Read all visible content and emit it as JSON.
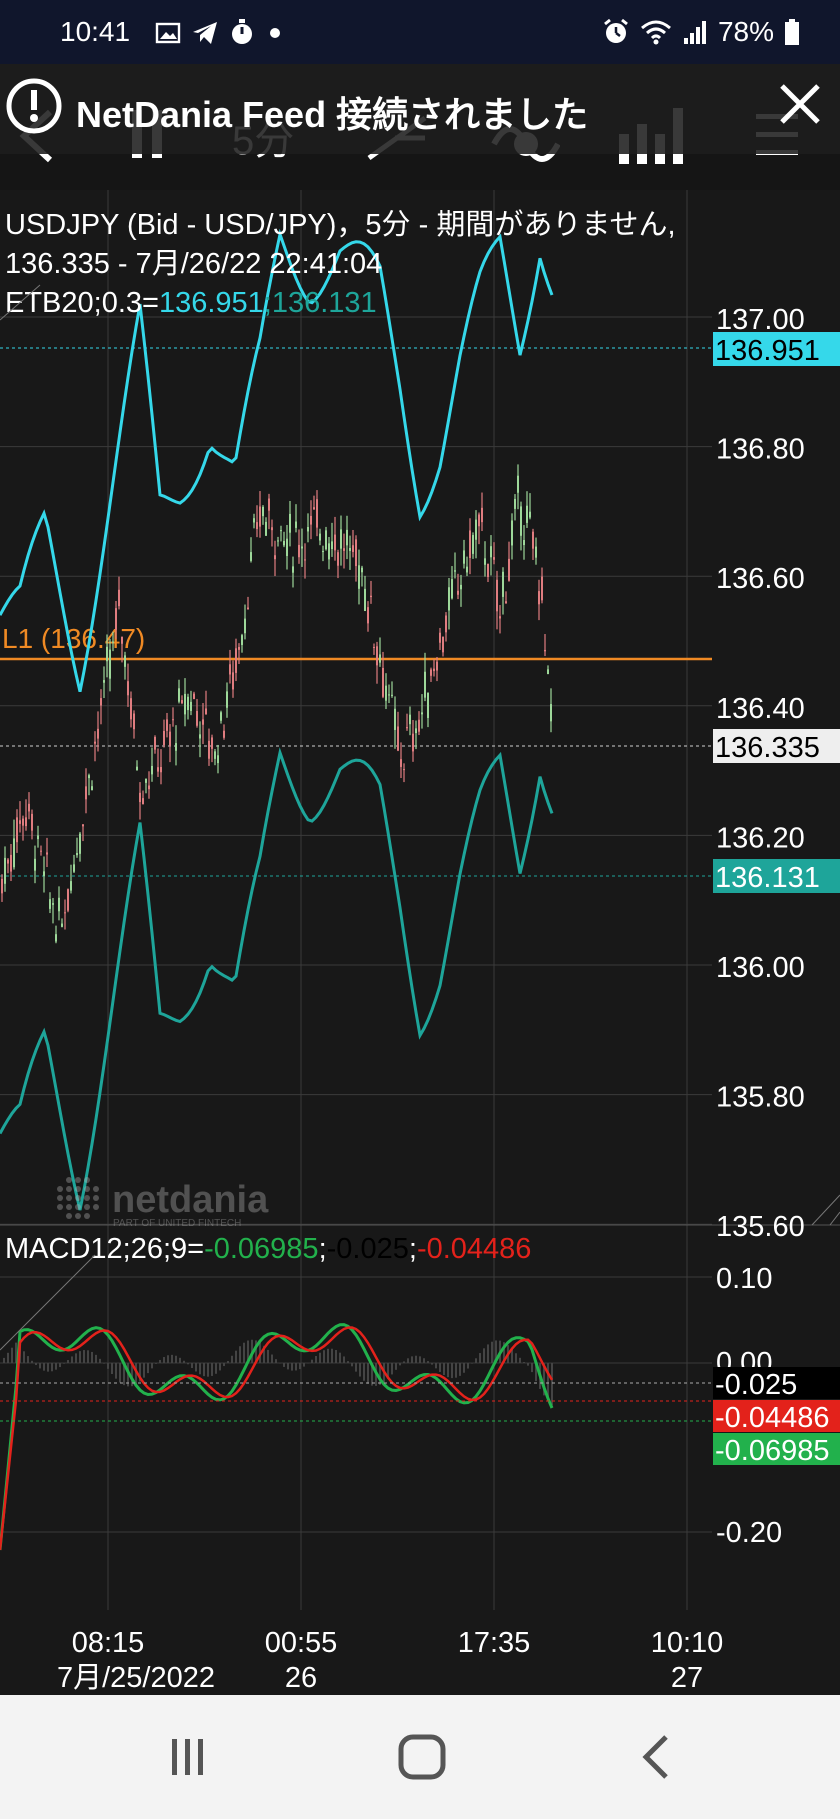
{
  "status_bar": {
    "time": "10:41",
    "battery": "78%",
    "left_icons": [
      "image-icon",
      "telegram-icon",
      "stopwatch-icon",
      "dot-icon"
    ],
    "right_icons": [
      "alarm-icon",
      "wifi-icon",
      "signal-icon",
      "battery-icon"
    ]
  },
  "toolbar": {
    "interval_label": "5分",
    "icons": [
      "back-icon",
      "pause-icon",
      "draw-line-icon",
      "indicator-icon",
      "chart-type-icon",
      "menu-icon"
    ]
  },
  "toast": {
    "message": "NetDania Feed 接続されました",
    "icons": [
      "warning-icon",
      "close-icon"
    ]
  },
  "chart": {
    "header_line1": "USDJPY (Bid - USD/JPY)，5分 - 期間がありません,",
    "header_line2": "136.335 - 7月/26/22 22:41:04",
    "etb_label": "ETB20;0.3=",
    "etb_upper": "136.951",
    "etb_sep": ";",
    "etb_lower": "136.131",
    "level_line_label": "L1 (136.47)",
    "price_axis_ticks": [
      "137.00",
      "136.80",
      "136.60",
      "136.40",
      "136.20",
      "136.00",
      "135.80",
      "135.60"
    ],
    "price_badges": {
      "upper_band": "136.951",
      "last_price": "136.335",
      "lower_band": "136.131"
    },
    "watermark": {
      "name": "netdania",
      "sub": "PART OF UNITED FINTECH"
    },
    "macd_label": "MACD12;26;9=",
    "macd_value": "-0.06985",
    "macd_signal": "-0.025",
    "macd_hist": "-0.04486",
    "macd_axis_ticks": [
      "0.10",
      "0.00",
      "-0.20"
    ],
    "macd_badges": [
      "-0.025",
      "-0.04486",
      "-0.06985"
    ],
    "time_axis": [
      {
        "time": "08:15",
        "date": "7月/25/2022"
      },
      {
        "time": "00:55",
        "date": "26"
      },
      {
        "time": "17:35",
        "date": ""
      },
      {
        "time": "10:10",
        "date": "27"
      }
    ],
    "colors": {
      "upper_band": "#35d8ea",
      "lower_band": "#1ea59a",
      "level_line": "#f08a24",
      "candle_up": "#9ed89a",
      "candle_down": "#e07d80",
      "macd_line": "#22b14c",
      "signal_line": "#e3221b"
    }
  },
  "navbar": {
    "icons": [
      "recent-apps-icon",
      "home-icon",
      "back-nav-icon"
    ]
  }
}
